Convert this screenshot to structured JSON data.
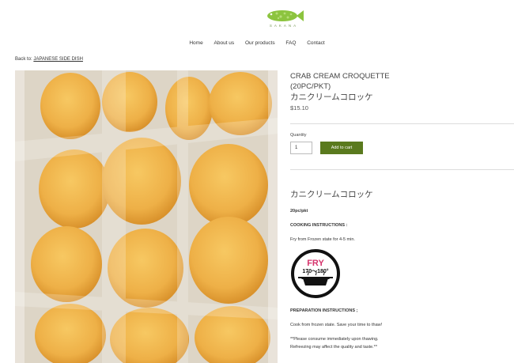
{
  "brand": {
    "name": "SAKANA"
  },
  "nav": {
    "items": [
      "Home",
      "About us",
      "Our products",
      "FAQ",
      "Contact"
    ]
  },
  "breadcrumb": {
    "prefix": "Back to:",
    "link": "JAPANESE SIDE DISH"
  },
  "product": {
    "title": "CRAB CREAM CROQUETTE",
    "subtitle": "(20PC/PKT)",
    "title_jp": "カニクリームコロッケ",
    "price": "$15.10"
  },
  "cart": {
    "quantity_label": "Quantity",
    "quantity_value": "1",
    "add_button": "Add to cart"
  },
  "description": {
    "heading_jp": "カニクリームコロッケ",
    "pack": "20pc/pkt",
    "cooking_title": "COOKING INSTRUCTIONS :",
    "cooking_text": "Fry from Frozen state for 4-5 min.",
    "fry_label": "FRY",
    "fry_temp": "170～180°",
    "prep_title": "PREPARATION INSTRUCTIONS ;",
    "prep_text": "Cook from frozen state.  Save your time to thaw!",
    "note_line1": "**Please consume immediately upon thawing.",
    "note_line2": "Refreezing may affect the quality and taste.**"
  },
  "colors": {
    "accent_green": "#5a7a1e",
    "fry_pink": "#d6336c"
  }
}
